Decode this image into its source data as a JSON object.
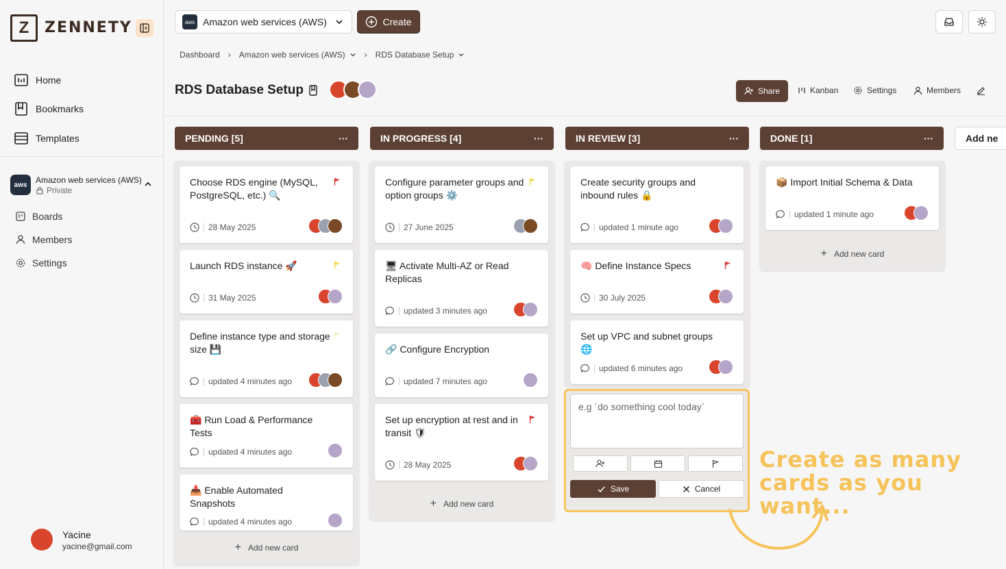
{
  "brand": {
    "logo_letter": "Z",
    "name": "ZENNETY"
  },
  "sidebar": {
    "nav": [
      {
        "label": "Home",
        "icon": "home-icon"
      },
      {
        "label": "Bookmarks",
        "icon": "bookmark-icon"
      },
      {
        "label": "Templates",
        "icon": "templates-icon"
      }
    ],
    "workspace": {
      "avatar": "aws",
      "name": "Amazon web services (AWS)",
      "visibility": "Private"
    },
    "sub_items": [
      {
        "label": "Boards",
        "icon": "boards-icon"
      },
      {
        "label": "Members",
        "icon": "members-icon"
      },
      {
        "label": "Settings",
        "icon": "settings-icon"
      }
    ],
    "user": {
      "name": "Yacine",
      "email": "yacine@gmail.com"
    }
  },
  "topbar": {
    "workspace_select": "Amazon web services (AWS)",
    "workspace_icon": "aws",
    "create_label": "Create"
  },
  "breadcrumb": [
    "Dashboard",
    "Amazon web services (AWS)",
    "RDS Database Setup"
  ],
  "board": {
    "title": "RDS Database Setup",
    "actions": {
      "share": "Share",
      "kanban": "Kanban",
      "settings": "Settings",
      "members": "Members"
    }
  },
  "columns": [
    {
      "title": "PENDING [5]",
      "cards": [
        {
          "title": "Choose RDS engine (MySQL, PostgreSQL, etc.) 🔍",
          "flag": "red",
          "meta": "28 May 2025",
          "meta_type": "date"
        },
        {
          "title": "Launch RDS instance 🚀",
          "flag": "yellow",
          "meta": "31 May 2025",
          "meta_type": "date"
        },
        {
          "title": "Define instance type and storage size 💾",
          "flag": "lightyellow",
          "meta": "updated 4 minutes ago",
          "meta_type": "comment"
        },
        {
          "title": "🧰 Run Load & Performance Tests",
          "flag": "",
          "meta": "updated 4 minutes ago",
          "meta_type": "comment"
        },
        {
          "title": "📥 Enable Automated Snapshots",
          "flag": "",
          "meta": "updated 4 minutes ago",
          "meta_type": "comment"
        }
      ],
      "add_label": "Add new card"
    },
    {
      "title": "IN PROGRESS [4]",
      "cards": [
        {
          "title": "Configure parameter groups and option groups ⚙️",
          "flag": "yellow",
          "meta": "27 June 2025",
          "meta_type": "date"
        },
        {
          "title": "🖥 Activate Multi-AZ or Read Replicas",
          "flag": "",
          "meta": "updated 3 minutes ago",
          "meta_type": "comment"
        },
        {
          "title": "🔗 Configure Encryption",
          "flag": "",
          "meta": "updated 7 minutes ago",
          "meta_type": "comment"
        },
        {
          "title": "Set up encryption at rest and in transit 🛡",
          "flag": "red",
          "meta": "28 May 2025",
          "meta_type": "date"
        }
      ],
      "add_label": "Add new card"
    },
    {
      "title": "IN REVIEW [3]",
      "cards": [
        {
          "title": "Create security groups and inbound rules 🔒",
          "flag": "",
          "meta": "updated 1 minute ago",
          "meta_type": "comment"
        },
        {
          "title": "🧠 Define Instance Specs",
          "flag": "red",
          "meta": "30 July 2025",
          "meta_type": "date"
        },
        {
          "title": "Set up VPC and subnet groups 🌐",
          "flag": "",
          "meta": "updated 6 minutes ago",
          "meta_type": "comment"
        }
      ],
      "new_card": {
        "placeholder": "e.g `do something cool today`",
        "save": "Save",
        "cancel": "Cancel"
      }
    },
    {
      "title": "DONE [1]",
      "cards": [
        {
          "title": "📦 Import Initial Schema & Data",
          "flag": "",
          "meta": "updated 1 minute ago",
          "meta_type": "comment"
        }
      ],
      "add_label": "Add new card"
    }
  ],
  "add_column_label": "Add ne",
  "promo": {
    "line1": "Create as many",
    "line2": "cards as you want..."
  },
  "colors": {
    "brown": "#5c4033",
    "accent": "#f6c35b",
    "flag_red": "#e03b3b",
    "flag_yellow": "#f5d94a"
  }
}
